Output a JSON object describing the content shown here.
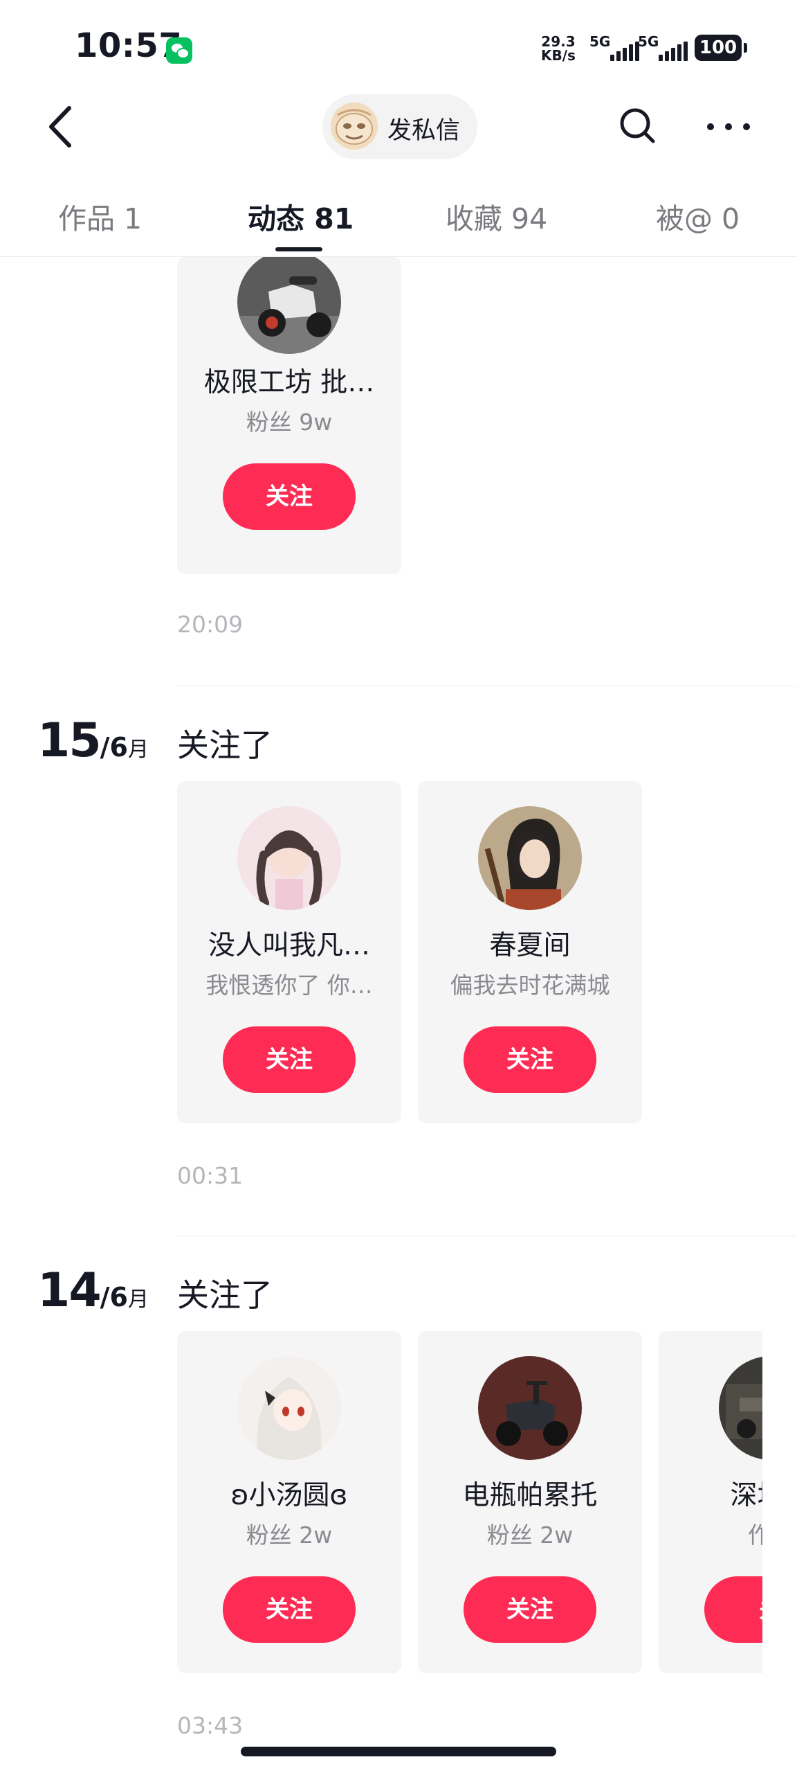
{
  "status_bar": {
    "time": "10:57",
    "net_speed_value": "29.3",
    "net_speed_unit": "KB/s",
    "sim1": "5G",
    "sim2": "5G",
    "battery": "100"
  },
  "header": {
    "dm_label": "发私信"
  },
  "tabs": [
    {
      "label": "作品 1",
      "active": false
    },
    {
      "label": "动态 81",
      "active": true
    },
    {
      "label": "收藏 94",
      "active": false
    },
    {
      "label": "被@ 0",
      "active": false
    }
  ],
  "feed": {
    "top_group": {
      "card": {
        "name": "极限工坊 批…",
        "sub": "粉丝 9w",
        "button": "关注"
      },
      "time": "20:09"
    },
    "group_15": {
      "day": "15",
      "month": "/6",
      "month_suffix": "月",
      "action": "关注了",
      "cards": [
        {
          "name": "没人叫我凡…",
          "sub": "我恨透你了 你…",
          "button": "关注"
        },
        {
          "name": "春夏间",
          "sub": "偏我去时花满城",
          "button": "关注"
        }
      ],
      "time": "00:31"
    },
    "group_14": {
      "day": "14",
      "month": "/6",
      "month_suffix": "月",
      "action": "关注了",
      "cards": [
        {
          "name": "ʚ小汤圆ɞ",
          "sub": "粉丝 2w",
          "button": "关注"
        },
        {
          "name": "电瓶帕累托",
          "sub": "粉丝 2w",
          "button": "关注"
        },
        {
          "name": "深圳大",
          "sub": "作品",
          "button": "关"
        }
      ],
      "time": "03:43"
    }
  },
  "colors": {
    "accent": "#fe2c55",
    "card_bg": "#f5f5f5",
    "text": "#161823",
    "muted": "#8a8b91"
  }
}
